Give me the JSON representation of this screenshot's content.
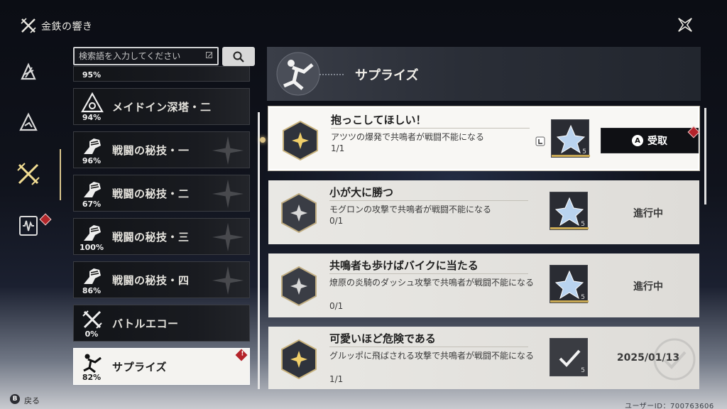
{
  "header": {
    "title": "金鉄の響き",
    "logo_icon": "crossed-swords-icon",
    "close_icon": "close-star-icon"
  },
  "nav": [
    {
      "icon": "triangle-rune-icon"
    },
    {
      "icon": "mountain-rune-icon"
    },
    {
      "icon": "crossed-swords-icon",
      "active": true,
      "alert": true
    },
    {
      "icon": "soundwave-icon"
    }
  ],
  "search": {
    "placeholder": "検索語を入力してください",
    "button_icon": "search-icon"
  },
  "categories": [
    {
      "pct": "95%",
      "name": ""
    },
    {
      "pct": "94%",
      "name": "メイドイン深塔・二",
      "icon": "tower-icon"
    },
    {
      "pct": "96%",
      "name": "戦闘の秘技・一",
      "icon": "fist-icon"
    },
    {
      "pct": "67%",
      "name": "戦闘の秘技・二",
      "icon": "fist-icon"
    },
    {
      "pct": "100%",
      "name": "戦闘の秘技・三",
      "icon": "fist-icon"
    },
    {
      "pct": "86%",
      "name": "戦闘の秘技・四",
      "icon": "fist-icon"
    },
    {
      "pct": "0%",
      "name": "バトルエコー",
      "icon": "crossed-swords-icon"
    },
    {
      "pct": "82%",
      "name": "サプライズ",
      "icon": "falling-person-icon",
      "active": true,
      "alert": "!"
    }
  ],
  "panel": {
    "title": "サプライズ"
  },
  "achievements": [
    {
      "title": "抱っこしてほしい！",
      "desc": "アツツの爆発で共鳴者が戦闘不能になる",
      "progress": "1/1",
      "reward_qty": "5",
      "action": "受取",
      "action_button": "A",
      "active": true
    },
    {
      "title": "小が大に勝つ",
      "desc": "モグロンの攻撃で共鳴者が戦闘不能になる",
      "progress": "0/1",
      "reward_qty": "5",
      "status": "進行中"
    },
    {
      "title": "共鳴者も歩けばバイクに当たる",
      "desc": "燎原の炎騎のダッシュ攻撃で共鳴者が戦闘不能になる",
      "progress": "0/1",
      "reward_qty": "5",
      "status": "進行中"
    },
    {
      "title": "可愛いほど危険である",
      "desc": "グルッポに飛ばされる攻撃で共鳴者が戦闘不能になる",
      "progress": "1/1",
      "reward_qty": "5",
      "status": "2025/01/13"
    }
  ],
  "footer": {
    "b_button": "B",
    "back": "戻る",
    "uid": "ユーザーID：700763606"
  },
  "colors": {
    "accent_gold": "#d9c084",
    "alert_red": "#b4232a",
    "active_bg": "#f8f7f4"
  }
}
